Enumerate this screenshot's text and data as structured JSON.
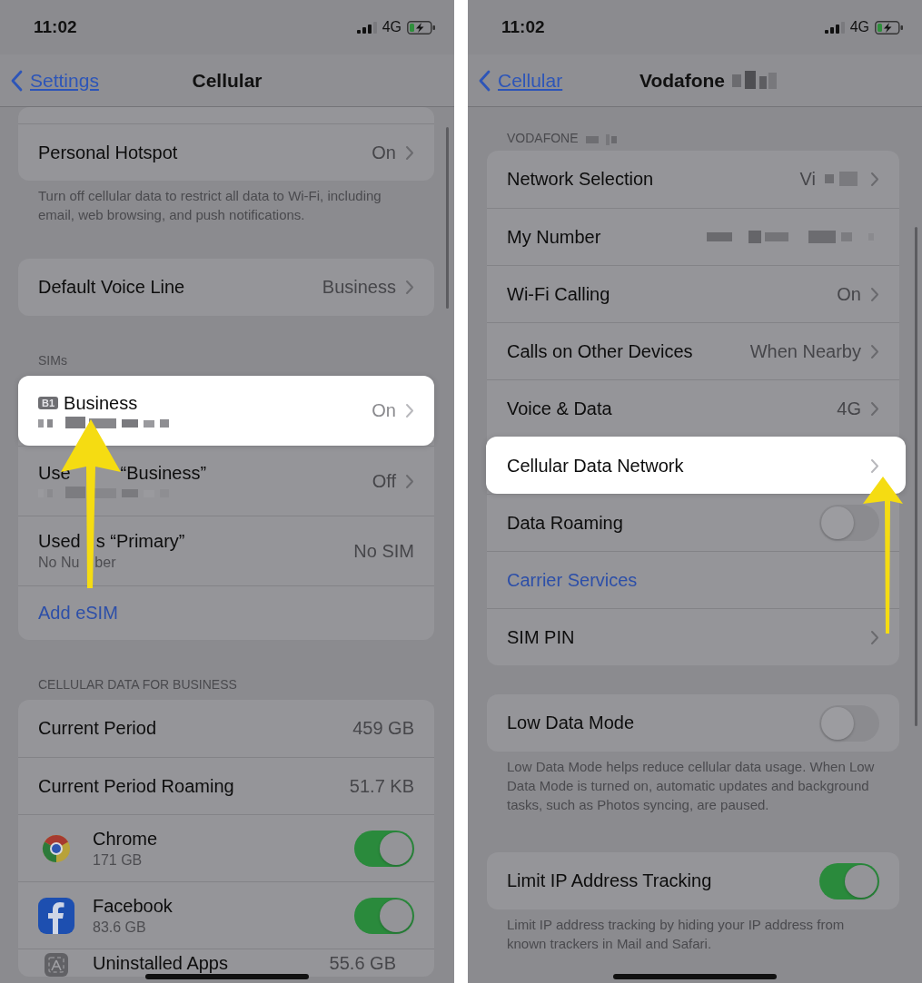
{
  "left_screen": {
    "status": {
      "time": "11:02",
      "network": "4G"
    },
    "nav": {
      "back": "Settings",
      "title": "Cellular",
      "title_masked": false
    },
    "sections": [
      {
        "cut_top": true,
        "rows": [
          {
            "kind": "value",
            "label": "Personal Hotspot",
            "value": "On",
            "chevron": true,
            "highlighted": false
          }
        ],
        "footer": "Turn off cellular data to restrict all data to Wi-Fi, including email, web browsing, and push notifications."
      },
      {
        "rows": [
          {
            "kind": "value",
            "label": "Default Voice Line",
            "value": "Business",
            "chevron": true,
            "highlighted": false
          }
        ]
      },
      {
        "header": "SIMs",
        "rows": [
          {
            "kind": "sim",
            "badge": "B1",
            "label": "Business",
            "detail_masked": true,
            "value": "On",
            "chevron": true,
            "highlighted": true
          },
          {
            "kind": "sim",
            "label_parts": [
              "Use",
              "“Business”"
            ],
            "detail_masked": true,
            "value": "Off",
            "chevron": true,
            "highlighted": false
          },
          {
            "kind": "sim",
            "label_parts": [
              "Used",
              "s “Primary”"
            ],
            "detail_parts": [
              "No Nu",
              "ber"
            ],
            "value": "No SIM",
            "chevron": false,
            "highlighted": false
          },
          {
            "kind": "link",
            "label": "Add eSIM"
          }
        ]
      },
      {
        "header": "CELLULAR DATA FOR BUSINESS",
        "rows": [
          {
            "kind": "value",
            "label": "Current Period",
            "value": "459 GB",
            "chevron": false,
            "highlighted": false
          },
          {
            "kind": "value",
            "label": "Current Period Roaming",
            "value": "51.7 KB",
            "chevron": false,
            "highlighted": false
          },
          {
            "kind": "app",
            "label": "Chrome",
            "detail": "171 GB",
            "on": true
          },
          {
            "kind": "app",
            "label": "Facebook",
            "detail": "83.6 GB",
            "on": true
          },
          {
            "kind": "app",
            "label": "Uninstalled Apps",
            "value": "55.6 GB"
          }
        ]
      }
    ]
  },
  "right_screen": {
    "status": {
      "time": "11:02",
      "network": "4G"
    },
    "nav": {
      "back": "Cellular",
      "title": "Vodafone",
      "title_masked": true
    },
    "sections": [
      {
        "header": "VODAFONE",
        "header_masked": true,
        "rows": [
          {
            "kind": "value",
            "label": "Network Selection",
            "value": "Vi",
            "value_masked": true,
            "chevron": true,
            "highlighted": false
          },
          {
            "kind": "value",
            "label": "My Number",
            "value_masked": true,
            "chevron": false,
            "highlighted": false
          },
          {
            "kind": "value",
            "label": "Wi-Fi Calling",
            "value": "On",
            "chevron": true,
            "highlighted": false
          },
          {
            "kind": "value",
            "label": "Calls on Other Devices",
            "value": "When Nearby",
            "chevron": true,
            "highlighted": false
          },
          {
            "kind": "value",
            "label": "Voice & Data",
            "value": "4G",
            "chevron": true,
            "highlighted": false
          },
          {
            "kind": "value",
            "label": "Cellular Data Network",
            "chevron": true,
            "highlighted": true
          },
          {
            "kind": "toggle",
            "label": "Data Roaming",
            "on": false
          },
          {
            "kind": "link",
            "label": "Carrier Services"
          },
          {
            "kind": "value",
            "label": "SIM PIN",
            "chevron": true,
            "highlighted": false
          }
        ]
      },
      {
        "rows": [
          {
            "kind": "toggle",
            "label": "Low Data Mode",
            "on": false
          }
        ],
        "footer": "Low Data Mode helps reduce cellular data usage. When Low Data Mode is turned on, automatic updates and background tasks, such as Photos syncing, are paused."
      },
      {
        "rows": [
          {
            "kind": "toggle",
            "label": "Limit IP Address Tracking",
            "on": true
          }
        ],
        "footer": "Limit IP address tracking by hiding your IP address from known trackers in Mail and Safari."
      }
    ]
  }
}
